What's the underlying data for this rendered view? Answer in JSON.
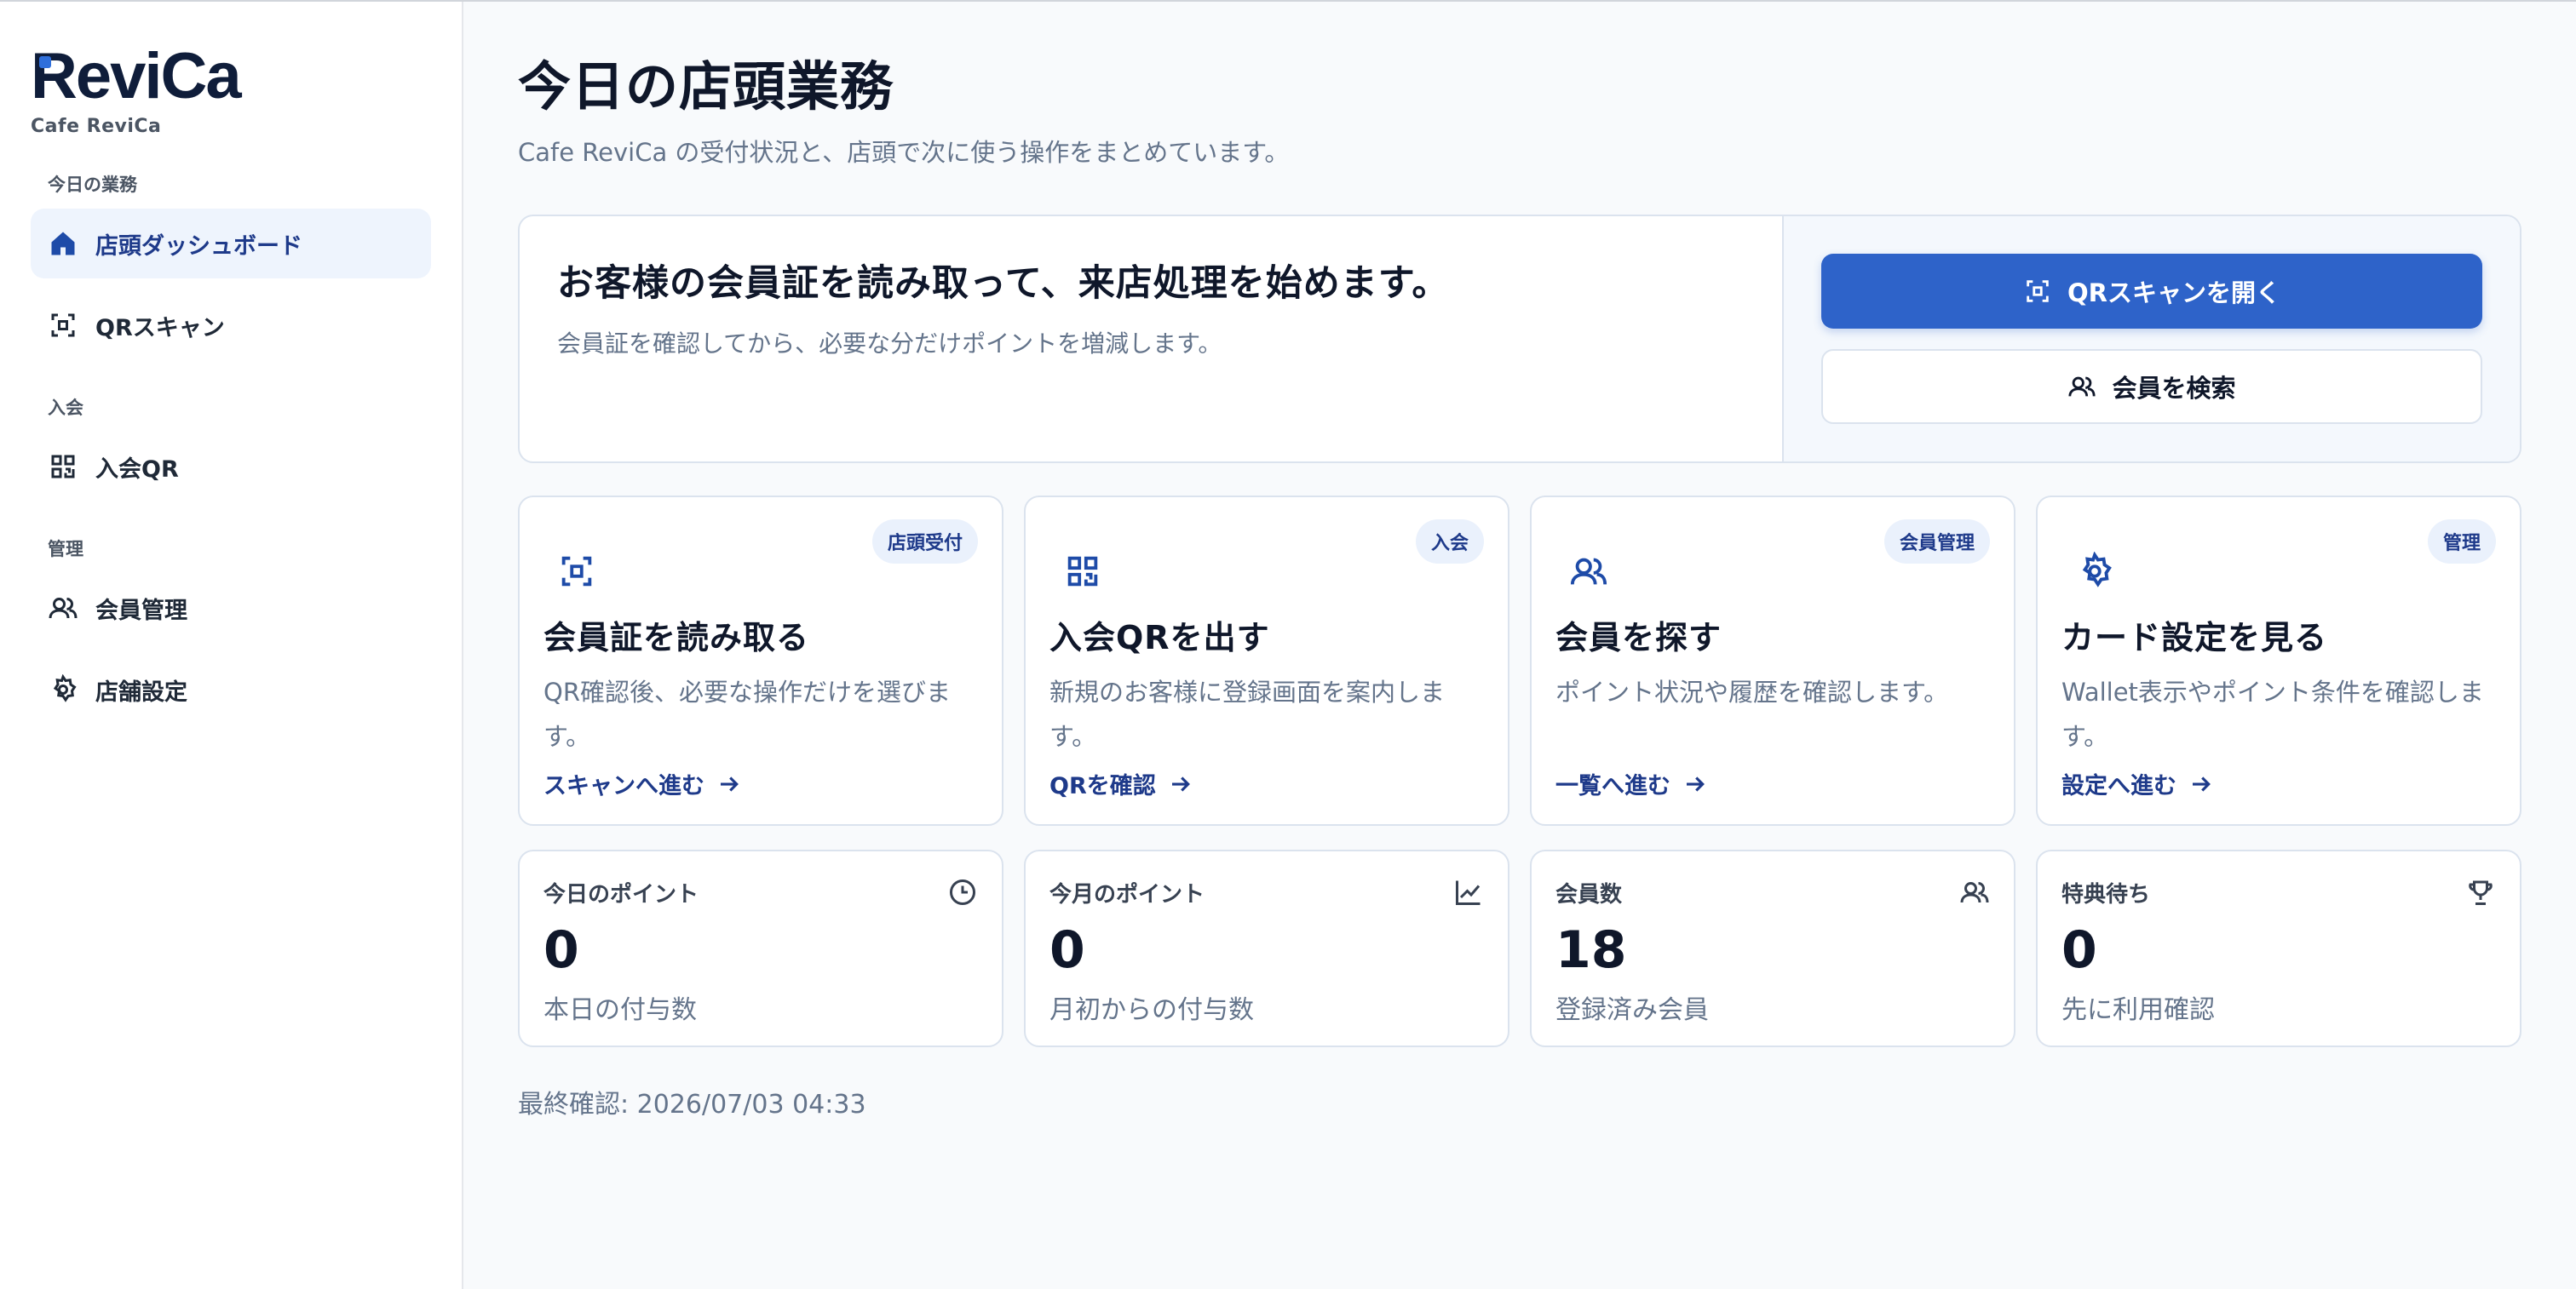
{
  "brand": {
    "logo": "ReviCa",
    "store": "Cafe ReviCa"
  },
  "sidebar": {
    "sections": [
      {
        "label": "今日の業務"
      },
      {
        "label": "入会"
      },
      {
        "label": "管理"
      }
    ],
    "items": [
      {
        "label": "店頭ダッシュボード",
        "icon": "home-icon",
        "active": true
      },
      {
        "label": "QRスキャン",
        "icon": "scan-icon"
      },
      {
        "label": "入会QR",
        "icon": "qr-icon"
      },
      {
        "label": "会員管理",
        "icon": "users-icon"
      },
      {
        "label": "店舗設定",
        "icon": "gear-icon"
      }
    ]
  },
  "header": {
    "title": "今日の店頭業務",
    "description": "Cafe ReviCa の受付状況と、店頭で次に使う操作をまとめています。"
  },
  "hero": {
    "title": "お客様の会員証を読み取って、来店処理を始めます。",
    "description": "会員証を確認してから、必要な分だけポイントを増減します。",
    "primary_button": "QRスキャンを開く",
    "secondary_button": "会員を検索"
  },
  "cards": [
    {
      "badge": "店頭受付",
      "title": "会員証を読み取る",
      "description": "QR確認後、必要な操作だけを選びます。",
      "link": "スキャンへ進む",
      "icon": "scan-icon"
    },
    {
      "badge": "入会",
      "title": "入会QRを出す",
      "description": "新規のお客様に登録画面を案内します。",
      "link": "QRを確認",
      "icon": "qr-icon"
    },
    {
      "badge": "会員管理",
      "title": "会員を探す",
      "description": "ポイント状況や履歴を確認します。",
      "link": "一覧へ進む",
      "icon": "users-icon"
    },
    {
      "badge": "管理",
      "title": "カード設定を見る",
      "description": "Wallet表示やポイント条件を確認します。",
      "link": "設定へ進む",
      "icon": "gear-icon"
    }
  ],
  "stats": [
    {
      "label": "今日のポイント",
      "value": "0",
      "sub": "本日の付与数",
      "icon": "clock-icon"
    },
    {
      "label": "今月のポイント",
      "value": "0",
      "sub": "月初からの付与数",
      "icon": "chart-icon"
    },
    {
      "label": "会員数",
      "value": "18",
      "sub": "登録済み会員",
      "icon": "users-icon"
    },
    {
      "label": "特典待ち",
      "value": "0",
      "sub": "先に利用確認",
      "icon": "trophy-icon"
    }
  ],
  "footer": {
    "last_checked": "最終確認: 2026/07/03 04:33"
  },
  "colors": {
    "primary": "#2e63c9",
    "accent_text": "#1e3a8a",
    "active_bg": "#eef4fd"
  }
}
